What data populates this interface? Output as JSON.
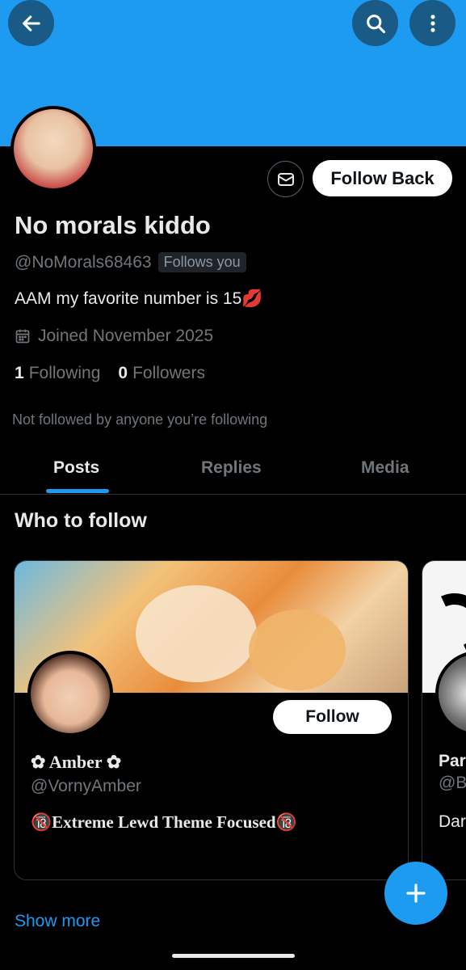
{
  "header": {
    "back_icon": "arrow-left-icon",
    "search_icon": "search-icon",
    "more_icon": "vertical-dots-icon"
  },
  "profile": {
    "name": "No morals kiddo",
    "handle": "@NoMorals68463",
    "follows_you": "Follows you",
    "bio": "AAM my favorite number is 15💋",
    "joined": "Joined November 2025",
    "following_count": "1",
    "following_label": "Following",
    "followers_count": "0",
    "followers_label": "Followers",
    "not_followed": "Not followed by anyone you’re following",
    "follow_back_label": "Follow Back"
  },
  "tabs": [
    {
      "label": "Posts",
      "active": true
    },
    {
      "label": "Replies",
      "active": false
    },
    {
      "label": "Media",
      "active": false
    }
  ],
  "who_to_follow": {
    "title": "Who to follow",
    "cards": [
      {
        "name": "✿ Amber ✿",
        "handle": "@VornyAmber",
        "bio": "🔞Extreme Lewd Theme Focused🔞",
        "follow_label": "Follow"
      },
      {
        "name": "Par",
        "handle": "@B",
        "bio": "Dar"
      }
    ],
    "show_more": "Show more"
  },
  "colors": {
    "accent": "#1d9bf0",
    "background": "#000000",
    "muted": "#71767b"
  }
}
